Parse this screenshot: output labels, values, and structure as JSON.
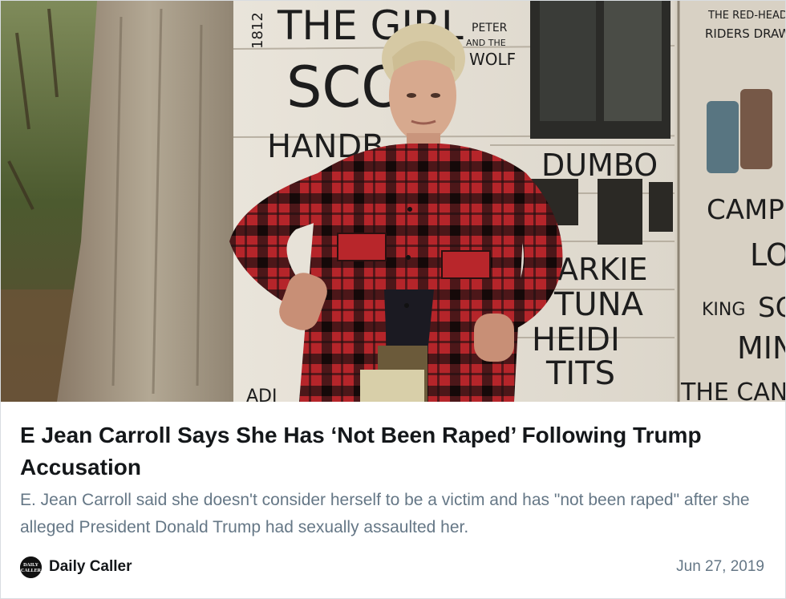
{
  "card": {
    "image": {
      "wall_text": {
        "year": "1812",
        "line1": "THE GIRL",
        "line2": "SCO",
        "line3": "HANDB",
        "peter_wolf": [
          "PETER",
          "AND THE",
          "WOLF"
        ],
        "dumbo": "DUMBO",
        "names": [
          "ARKIE",
          "TUNA",
          "HEIDI",
          "TITS"
        ],
        "right_top": [
          "THE RED-HEAD",
          "RIDERS DRAW"
        ],
        "right": [
          "CAMP",
          "LO",
          "KING",
          "SO",
          "MIN",
          "THE CAN"
        ],
        "bottom_left": "ADI"
      }
    },
    "headline": "E Jean Carroll Says She Has ‘Not Been Raped’ Following Trump Accusation",
    "summary": "E. Jean Carroll said she doesn't consider herself to be a victim and has \"not been raped\" after she alleged President Donald Trump had sexually assaulted her.",
    "source": {
      "logo_text": [
        "DAILY",
        "CALLER"
      ],
      "name": "Daily Caller"
    },
    "date": "Jun 27, 2019"
  },
  "colors": {
    "headline": "#14171a",
    "summary": "#657786",
    "border": "#d9dde1",
    "plaid_red": "#c0282d",
    "plaid_dark": "#1c0f10"
  }
}
